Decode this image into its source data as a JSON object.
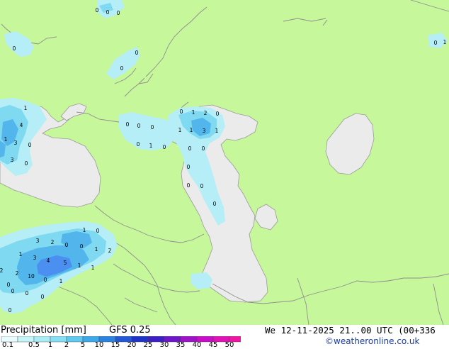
{
  "title": "Precipitation [mm]",
  "model": "GFS 0.25",
  "valid_time": "We 12-11-2025 21..00 UTC (00+336",
  "credit": "©weatheronline.co.uk",
  "colors": {
    "land": "#c6f79a",
    "water": "#ebebeb",
    "border": "#8f8f8f",
    "coast": "#9a9a9a",
    "precip_light": "#b5eef6",
    "precip_mid": "#7fd9f0",
    "precip_heavy": "#52b5ec",
    "precip_max": "#4b8ff0"
  },
  "legend": {
    "levels": [
      "0.1",
      "0.5",
      "1",
      "2",
      "5",
      "10",
      "15",
      "20",
      "25",
      "30",
      "35",
      "40",
      "45",
      "50"
    ],
    "colors": [
      "#e8fbfd",
      "#c5f4f9",
      "#a9ecf6",
      "#86e0f4",
      "#5fc9ef",
      "#3ea9ea",
      "#2c82e0",
      "#2458d6",
      "#1f33c8",
      "#3d1fc4",
      "#6d17c8",
      "#9e12c8",
      "#c80ec8",
      "#e012b6",
      "#f016a4"
    ]
  },
  "map_values": [
    {
      "v": "0"
    },
    {
      "v": "0"
    },
    {
      "v": "0"
    },
    {
      "v": "0"
    },
    {
      "v": "0"
    },
    {
      "v": "1"
    },
    {
      "v": "4"
    },
    {
      "v": "1"
    },
    {
      "v": "3"
    },
    {
      "v": "3"
    },
    {
      "v": "0"
    },
    {
      "v": "0"
    },
    {
      "v": "0"
    },
    {
      "v": "0"
    },
    {
      "v": "0"
    },
    {
      "v": "1"
    },
    {
      "v": "0"
    },
    {
      "v": "0"
    },
    {
      "v": "1"
    },
    {
      "v": "2"
    },
    {
      "v": "0"
    },
    {
      "v": "1"
    },
    {
      "v": "1"
    },
    {
      "v": "3"
    },
    {
      "v": "1"
    },
    {
      "v": "0"
    },
    {
      "v": "0"
    },
    {
      "v": "0"
    },
    {
      "v": "0"
    },
    {
      "v": "0"
    },
    {
      "v": "0"
    },
    {
      "v": "0"
    },
    {
      "v": "0"
    },
    {
      "v": "0"
    },
    {
      "v": "1"
    },
    {
      "v": "1"
    },
    {
      "v": "0"
    },
    {
      "v": "3"
    },
    {
      "v": "2"
    },
    {
      "v": "0"
    },
    {
      "v": "0"
    },
    {
      "v": "1"
    },
    {
      "v": "2"
    },
    {
      "v": "1"
    },
    {
      "v": "3"
    },
    {
      "v": "4"
    },
    {
      "v": "5"
    },
    {
      "v": "1"
    },
    {
      "v": "1"
    },
    {
      "v": "2"
    },
    {
      "v": "2"
    },
    {
      "v": "10"
    },
    {
      "v": "0"
    },
    {
      "v": "1"
    },
    {
      "v": "0"
    },
    {
      "v": "0"
    },
    {
      "v": "0"
    },
    {
      "v": "0"
    },
    {
      "v": "0"
    }
  ]
}
